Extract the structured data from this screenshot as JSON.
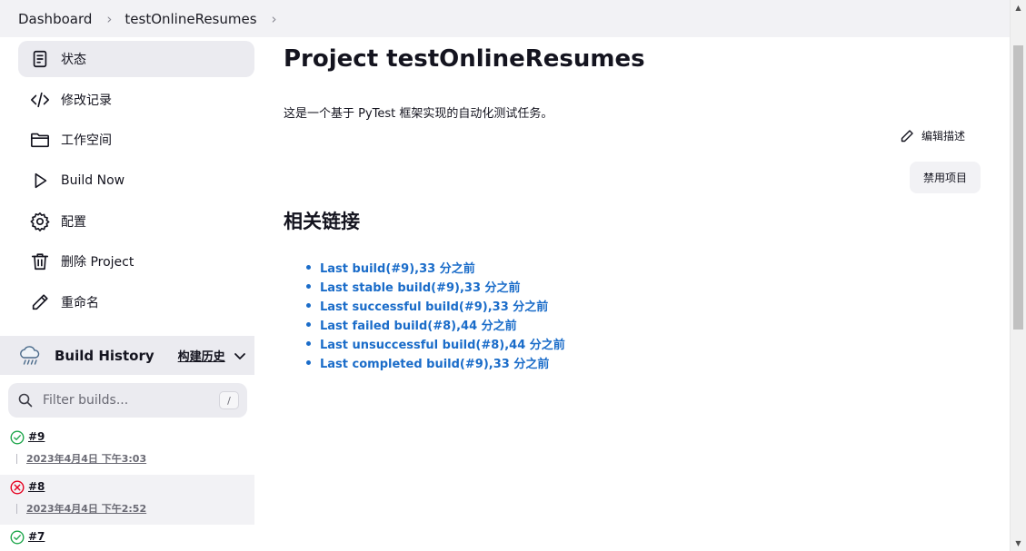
{
  "breadcrumb": {
    "items": [
      "Dashboard",
      "testOnlineResumes"
    ]
  },
  "sidebar": {
    "tasks": [
      {
        "label": "状态",
        "icon": "document-icon",
        "active": true
      },
      {
        "label": "修改记录",
        "icon": "code-icon",
        "active": false
      },
      {
        "label": "工作空间",
        "icon": "folder-icon",
        "active": false
      },
      {
        "label": "Build Now",
        "icon": "play-icon",
        "active": false
      },
      {
        "label": "配置",
        "icon": "gear-icon",
        "active": false
      },
      {
        "label": "删除 Project",
        "icon": "trash-icon",
        "active": false
      },
      {
        "label": "重命名",
        "icon": "pencil-icon",
        "active": false
      }
    ]
  },
  "build_history": {
    "title": "Build History",
    "trend_label": "构建历史",
    "filter_placeholder": "Filter builds...",
    "shortcut": "/",
    "builds": [
      {
        "number": "#9",
        "time": "2023年4月4日 下午3:03",
        "status": "success"
      },
      {
        "number": "#8",
        "time": "2023年4月4日 下午2:52",
        "status": "failed"
      },
      {
        "number": "#7",
        "time": "",
        "status": "success"
      }
    ]
  },
  "main": {
    "title": "Project testOnlineResumes",
    "description": "这是一个基于 PyTest 框架实现的自动化测试任务。",
    "edit_description": "编辑描述",
    "disable_button": "禁用项目",
    "related_heading": "相关链接",
    "links": [
      "Last build(#9),33 分之前",
      "Last stable build(#9),33 分之前",
      "Last successful build(#9),33 分之前",
      "Last failed build(#8),44 分之前",
      "Last unsuccessful build(#8),44 分之前",
      "Last completed build(#9),33 分之前"
    ]
  },
  "colors": {
    "link": "#1a6cc9",
    "success": "#1ea64b",
    "failed": "#e6001f",
    "topbar": "#f2f2f5"
  }
}
